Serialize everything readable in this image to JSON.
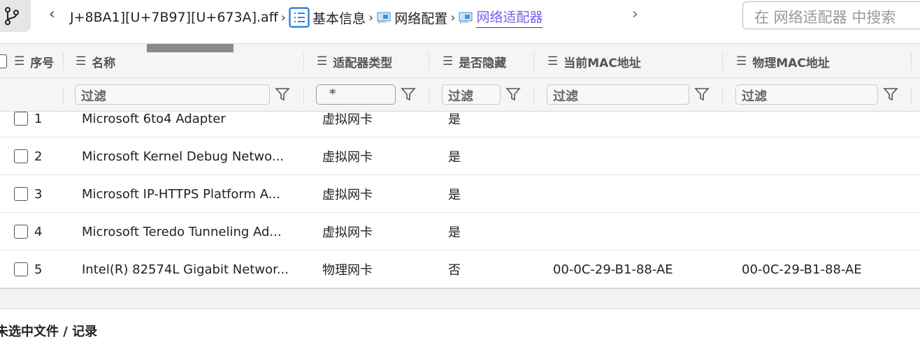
{
  "breadcrumb": {
    "file": "J+8BA1][U+7B97][U+673A].aff",
    "items": [
      "基本信息",
      "网络配置",
      "网络适配器"
    ]
  },
  "search": {
    "placeholder": "在 网络适配器 中搜索"
  },
  "columns": [
    "序号",
    "名称",
    "适配器类型",
    "是否隐藏",
    "当前MAC地址",
    "物理MAC地址"
  ],
  "filters": {
    "placeholder": "过滤",
    "type_value": "*"
  },
  "rows": [
    {
      "index": "1",
      "name": "Microsoft 6to4 Adapter",
      "type": "虚拟网卡",
      "hidden": "是",
      "mac": "",
      "phys_mac": ""
    },
    {
      "index": "2",
      "name": "Microsoft Kernel Debug Netwo...",
      "type": "虚拟网卡",
      "hidden": "是",
      "mac": "",
      "phys_mac": ""
    },
    {
      "index": "3",
      "name": "Microsoft IP-HTTPS Platform A...",
      "type": "虚拟网卡",
      "hidden": "是",
      "mac": "",
      "phys_mac": ""
    },
    {
      "index": "4",
      "name": "Microsoft Teredo Tunneling Ad...",
      "type": "虚拟网卡",
      "hidden": "是",
      "mac": "",
      "phys_mac": ""
    },
    {
      "index": "5",
      "name": "Intel(R) 82574L Gigabit Networ...",
      "type": "物理网卡",
      "hidden": "否",
      "mac": "00-0C-29-B1-88-AE",
      "phys_mac": "00-0C-29-B1-88-AE"
    }
  ],
  "status": "未选中文件 / 记录",
  "colors": {
    "accent": "#7b5cf0",
    "icon_blue": "#2f86d8"
  }
}
